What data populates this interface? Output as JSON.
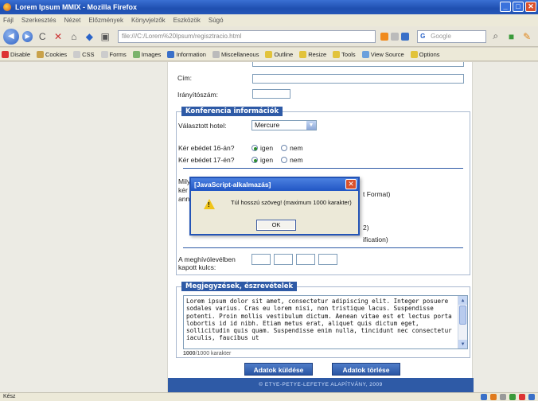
{
  "window": {
    "title": "Lorem Ipsum MMIX - Mozilla Firefox",
    "min": "_",
    "max": "□",
    "close": "✕"
  },
  "menu": [
    "Fájl",
    "Szerkesztés",
    "Nézet",
    "Előzmények",
    "Könyvjelzők",
    "Eszközök",
    "Súgó"
  ],
  "nav": {
    "url": "file:///C:/Lorem%20Ipsum/regisztracio.html",
    "search_placeholder": "Google"
  },
  "devbar": [
    "Disable",
    "Cookies",
    "CSS",
    "Forms",
    "Images",
    "Information",
    "Miscellaneous",
    "Outline",
    "Resize",
    "Tools",
    "View Source",
    "Options"
  ],
  "form": {
    "cim_label": "Cím:",
    "irsz_label": "Irányítószám:",
    "conf_legend": "Konferencia információk",
    "hotel_label": "Választott hotel:",
    "hotel_value": "Mercure",
    "lunch16_label": "Kér ebédet 16-án?",
    "lunch17_label": "Kér ebédet 17-én?",
    "igen": "igen",
    "nem": "nem",
    "partial_1": "Mily",
    "partial_2": "kér",
    "partial_3": "ann",
    "partial_right_1": "t Format)",
    "partial_right_2": "2)",
    "partial_right_3": "ification)",
    "key_label": "A meghívólevélben kapott kulcs:",
    "notes_legend": "Megjegyzések, észrevételek",
    "notes_text": "Lorem ipsum dolor sit amet, consectetur adipiscing elit. Integer posuere sodales varius. Cras eu lorem nisi, non tristique lacus. Suspendisse potenti. Proin mollis vestibulum dictum. Aenean vitae est et lectus porta lobortis id id nibh. Etiam metus erat, aliquet quis dictum eget, sollicitudin quis quam. Suspendisse enim nulla, tincidunt nec consectetur iaculis, faucibus ut",
    "counter_value": "1000",
    "counter_suffix": "/1000 karakter",
    "submit": "Adatok küldése",
    "reset": "Adatok törlése",
    "footer": "© ETYE-PETYE-LEFETYE ALAPÍTVÁNY, 2009"
  },
  "dialog": {
    "title": "[JavaScript-alkalmazás]",
    "message": "Túl hosszú szöveg! (maximum 1000 karakter)",
    "ok": "OK",
    "close": "✕"
  },
  "status": "Kész"
}
